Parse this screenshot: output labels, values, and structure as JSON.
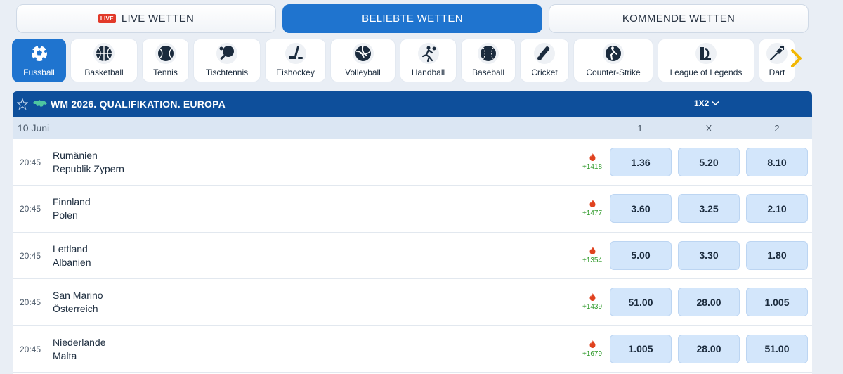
{
  "top_tabs": {
    "live_badge": "LIVE",
    "live_label": "LIVE WETTEN",
    "popular_label": "BELIEBTE WETTEN",
    "upcoming_label": "KOMMENDE WETTEN"
  },
  "sports": [
    {
      "label": "Fussball",
      "icon": "soccer-ball-icon"
    },
    {
      "label": "Basketball",
      "icon": "basketball-icon"
    },
    {
      "label": "Tennis",
      "icon": "tennis-ball-icon"
    },
    {
      "label": "Tischtennis",
      "icon": "table-tennis-icon"
    },
    {
      "label": "Eishockey",
      "icon": "ice-hockey-icon"
    },
    {
      "label": "Volleyball",
      "icon": "volleyball-icon"
    },
    {
      "label": "Handball",
      "icon": "handball-icon"
    },
    {
      "label": "Baseball",
      "icon": "baseball-icon"
    },
    {
      "label": "Cricket",
      "icon": "cricket-icon"
    },
    {
      "label": "Counter-Strike",
      "icon": "counter-strike-icon"
    },
    {
      "label": "League of Legends",
      "icon": "league-of-legends-icon"
    },
    {
      "label": "Dart",
      "icon": "dart-icon"
    }
  ],
  "league": {
    "title": "WM 2026. QUALIFIKATION. EUROPA",
    "market": "1X2",
    "date": "10 Juni",
    "columns": [
      "1",
      "X",
      "2"
    ]
  },
  "matches": [
    {
      "time": "20:45",
      "team1": "Rumänien",
      "team2": "Republik Zypern",
      "count": "+1418",
      "odds": [
        "1.36",
        "5.20",
        "8.10"
      ]
    },
    {
      "time": "20:45",
      "team1": "Finnland",
      "team2": "Polen",
      "count": "+1477",
      "odds": [
        "3.60",
        "3.25",
        "2.10"
      ]
    },
    {
      "time": "20:45",
      "team1": "Lettland",
      "team2": "Albanien",
      "count": "+1354",
      "odds": [
        "5.00",
        "3.30",
        "1.80"
      ]
    },
    {
      "time": "20:45",
      "team1": "San Marino",
      "team2": "Österreich",
      "count": "+1439",
      "odds": [
        "51.00",
        "28.00",
        "1.005"
      ]
    },
    {
      "time": "20:45",
      "team1": "Niederlande",
      "team2": "Malta",
      "count": "+1679",
      "odds": [
        "1.005",
        "28.00",
        "51.00"
      ]
    }
  ],
  "colors": {
    "accent": "#1f74cf",
    "header": "#0e4f9b",
    "odd_bg": "#d3e6fb",
    "live_red": "#e23a2a",
    "count_green": "#2f9a2a",
    "arrow": "#f2b705"
  }
}
